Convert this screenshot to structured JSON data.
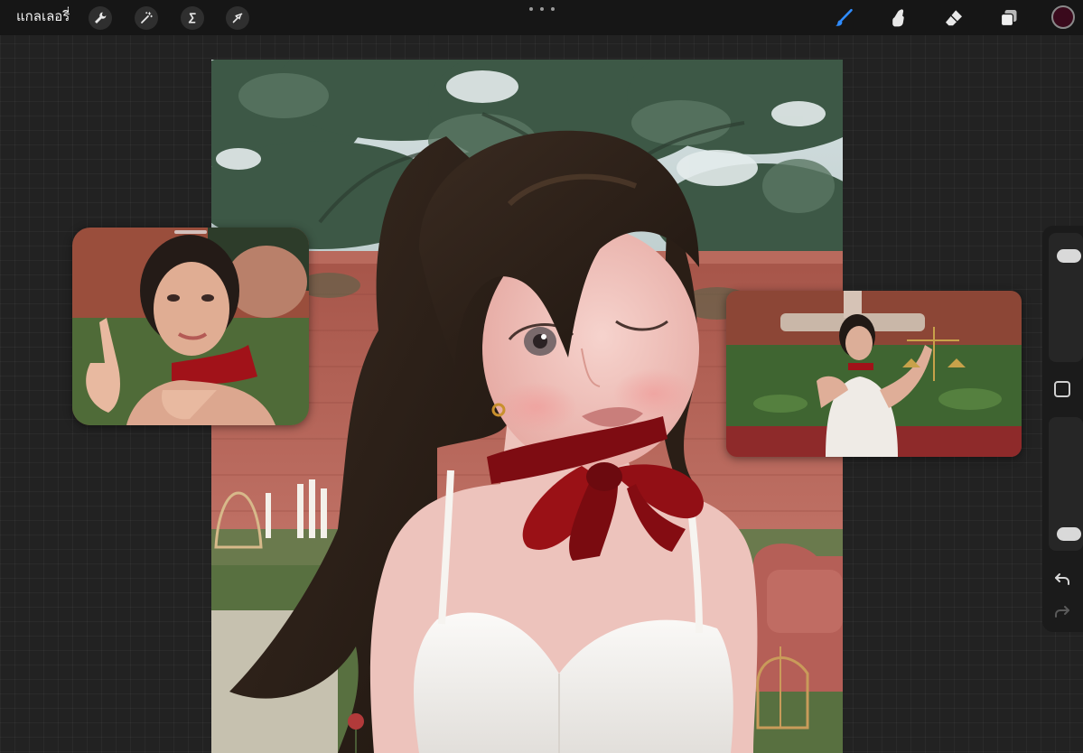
{
  "toolbar": {
    "gallery_label": "แกลเลอรี่",
    "left_tools": [
      {
        "name": "actions",
        "icon": "wrench-icon"
      },
      {
        "name": "adjustments",
        "icon": "magic-wand-icon"
      },
      {
        "name": "selection",
        "icon": "selection-s-icon"
      },
      {
        "name": "transform",
        "icon": "arrow-cursor-icon"
      }
    ],
    "more_icon": "more-dots-icon",
    "right_tools": [
      {
        "name": "brush",
        "icon": "brush-icon",
        "active": true
      },
      {
        "name": "smudge",
        "icon": "smudge-finger-icon",
        "active": false
      },
      {
        "name": "eraser",
        "icon": "eraser-icon",
        "active": false
      },
      {
        "name": "layers",
        "icon": "layers-icon",
        "active": false
      }
    ],
    "current_color": "#3a0a1c",
    "active_tool_color": "#2f8cff"
  },
  "canvas": {
    "description_icon": "artwork-canvas",
    "palette": {
      "sky": "#dfe7e6",
      "foliage": "#3f5a46",
      "wall": "#b8665a",
      "hair": "#2d2119",
      "skin": "#efc3bd",
      "ribbon": "#8c0d12",
      "dress": "#f2f0ee"
    }
  },
  "references": [
    {
      "name": "reference-photo-1",
      "icon": "reference-image"
    },
    {
      "name": "reference-photo-2",
      "icon": "reference-image"
    }
  ],
  "sidebar": {
    "brush_size_level": 0.88,
    "opacity_level": 0.06,
    "modify_icon": "square-modify-icon",
    "undo_icon": "undo-arrow-icon",
    "redo_icon": "redo-arrow-icon"
  }
}
